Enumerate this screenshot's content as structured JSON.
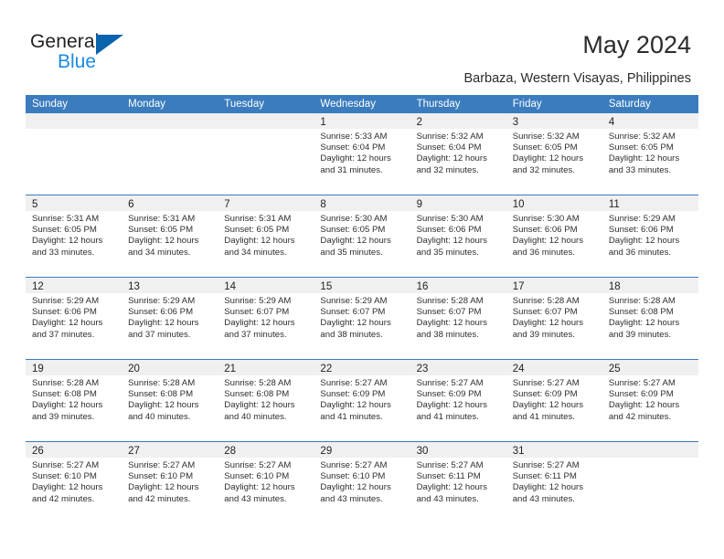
{
  "brand": {
    "name_primary": "General",
    "name_secondary": "Blue",
    "accent_color": "#0a64ac",
    "secondary_color": "#1b8ae0",
    "triangle_icon": "triangle-icon"
  },
  "header": {
    "title": "May 2024",
    "subtitle": "Barbaza, Western Visayas, Philippines"
  },
  "calendar": {
    "header_bg": "#3a7cbe",
    "daynum_bg": "#f0f0f0",
    "weekdays": [
      "Sunday",
      "Monday",
      "Tuesday",
      "Wednesday",
      "Thursday",
      "Friday",
      "Saturday"
    ],
    "weeks": [
      [
        {
          "day": "",
          "empty": true
        },
        {
          "day": "",
          "empty": true
        },
        {
          "day": "",
          "empty": true
        },
        {
          "day": "1",
          "sunrise": "Sunrise: 5:33 AM",
          "sunset": "Sunset: 6:04 PM",
          "daylight1": "Daylight: 12 hours",
          "daylight2": "and 31 minutes."
        },
        {
          "day": "2",
          "sunrise": "Sunrise: 5:32 AM",
          "sunset": "Sunset: 6:04 PM",
          "daylight1": "Daylight: 12 hours",
          "daylight2": "and 32 minutes."
        },
        {
          "day": "3",
          "sunrise": "Sunrise: 5:32 AM",
          "sunset": "Sunset: 6:05 PM",
          "daylight1": "Daylight: 12 hours",
          "daylight2": "and 32 minutes."
        },
        {
          "day": "4",
          "sunrise": "Sunrise: 5:32 AM",
          "sunset": "Sunset: 6:05 PM",
          "daylight1": "Daylight: 12 hours",
          "daylight2": "and 33 minutes."
        }
      ],
      [
        {
          "day": "5",
          "sunrise": "Sunrise: 5:31 AM",
          "sunset": "Sunset: 6:05 PM",
          "daylight1": "Daylight: 12 hours",
          "daylight2": "and 33 minutes."
        },
        {
          "day": "6",
          "sunrise": "Sunrise: 5:31 AM",
          "sunset": "Sunset: 6:05 PM",
          "daylight1": "Daylight: 12 hours",
          "daylight2": "and 34 minutes."
        },
        {
          "day": "7",
          "sunrise": "Sunrise: 5:31 AM",
          "sunset": "Sunset: 6:05 PM",
          "daylight1": "Daylight: 12 hours",
          "daylight2": "and 34 minutes."
        },
        {
          "day": "8",
          "sunrise": "Sunrise: 5:30 AM",
          "sunset": "Sunset: 6:05 PM",
          "daylight1": "Daylight: 12 hours",
          "daylight2": "and 35 minutes."
        },
        {
          "day": "9",
          "sunrise": "Sunrise: 5:30 AM",
          "sunset": "Sunset: 6:06 PM",
          "daylight1": "Daylight: 12 hours",
          "daylight2": "and 35 minutes."
        },
        {
          "day": "10",
          "sunrise": "Sunrise: 5:30 AM",
          "sunset": "Sunset: 6:06 PM",
          "daylight1": "Daylight: 12 hours",
          "daylight2": "and 36 minutes."
        },
        {
          "day": "11",
          "sunrise": "Sunrise: 5:29 AM",
          "sunset": "Sunset: 6:06 PM",
          "daylight1": "Daylight: 12 hours",
          "daylight2": "and 36 minutes."
        }
      ],
      [
        {
          "day": "12",
          "sunrise": "Sunrise: 5:29 AM",
          "sunset": "Sunset: 6:06 PM",
          "daylight1": "Daylight: 12 hours",
          "daylight2": "and 37 minutes."
        },
        {
          "day": "13",
          "sunrise": "Sunrise: 5:29 AM",
          "sunset": "Sunset: 6:06 PM",
          "daylight1": "Daylight: 12 hours",
          "daylight2": "and 37 minutes."
        },
        {
          "day": "14",
          "sunrise": "Sunrise: 5:29 AM",
          "sunset": "Sunset: 6:07 PM",
          "daylight1": "Daylight: 12 hours",
          "daylight2": "and 37 minutes."
        },
        {
          "day": "15",
          "sunrise": "Sunrise: 5:29 AM",
          "sunset": "Sunset: 6:07 PM",
          "daylight1": "Daylight: 12 hours",
          "daylight2": "and 38 minutes."
        },
        {
          "day": "16",
          "sunrise": "Sunrise: 5:28 AM",
          "sunset": "Sunset: 6:07 PM",
          "daylight1": "Daylight: 12 hours",
          "daylight2": "and 38 minutes."
        },
        {
          "day": "17",
          "sunrise": "Sunrise: 5:28 AM",
          "sunset": "Sunset: 6:07 PM",
          "daylight1": "Daylight: 12 hours",
          "daylight2": "and 39 minutes."
        },
        {
          "day": "18",
          "sunrise": "Sunrise: 5:28 AM",
          "sunset": "Sunset: 6:08 PM",
          "daylight1": "Daylight: 12 hours",
          "daylight2": "and 39 minutes."
        }
      ],
      [
        {
          "day": "19",
          "sunrise": "Sunrise: 5:28 AM",
          "sunset": "Sunset: 6:08 PM",
          "daylight1": "Daylight: 12 hours",
          "daylight2": "and 39 minutes."
        },
        {
          "day": "20",
          "sunrise": "Sunrise: 5:28 AM",
          "sunset": "Sunset: 6:08 PM",
          "daylight1": "Daylight: 12 hours",
          "daylight2": "and 40 minutes."
        },
        {
          "day": "21",
          "sunrise": "Sunrise: 5:28 AM",
          "sunset": "Sunset: 6:08 PM",
          "daylight1": "Daylight: 12 hours",
          "daylight2": "and 40 minutes."
        },
        {
          "day": "22",
          "sunrise": "Sunrise: 5:27 AM",
          "sunset": "Sunset: 6:09 PM",
          "daylight1": "Daylight: 12 hours",
          "daylight2": "and 41 minutes."
        },
        {
          "day": "23",
          "sunrise": "Sunrise: 5:27 AM",
          "sunset": "Sunset: 6:09 PM",
          "daylight1": "Daylight: 12 hours",
          "daylight2": "and 41 minutes."
        },
        {
          "day": "24",
          "sunrise": "Sunrise: 5:27 AM",
          "sunset": "Sunset: 6:09 PM",
          "daylight1": "Daylight: 12 hours",
          "daylight2": "and 41 minutes."
        },
        {
          "day": "25",
          "sunrise": "Sunrise: 5:27 AM",
          "sunset": "Sunset: 6:09 PM",
          "daylight1": "Daylight: 12 hours",
          "daylight2": "and 42 minutes."
        }
      ],
      [
        {
          "day": "26",
          "sunrise": "Sunrise: 5:27 AM",
          "sunset": "Sunset: 6:10 PM",
          "daylight1": "Daylight: 12 hours",
          "daylight2": "and 42 minutes."
        },
        {
          "day": "27",
          "sunrise": "Sunrise: 5:27 AM",
          "sunset": "Sunset: 6:10 PM",
          "daylight1": "Daylight: 12 hours",
          "daylight2": "and 42 minutes."
        },
        {
          "day": "28",
          "sunrise": "Sunrise: 5:27 AM",
          "sunset": "Sunset: 6:10 PM",
          "daylight1": "Daylight: 12 hours",
          "daylight2": "and 43 minutes."
        },
        {
          "day": "29",
          "sunrise": "Sunrise: 5:27 AM",
          "sunset": "Sunset: 6:10 PM",
          "daylight1": "Daylight: 12 hours",
          "daylight2": "and 43 minutes."
        },
        {
          "day": "30",
          "sunrise": "Sunrise: 5:27 AM",
          "sunset": "Sunset: 6:11 PM",
          "daylight1": "Daylight: 12 hours",
          "daylight2": "and 43 minutes."
        },
        {
          "day": "31",
          "sunrise": "Sunrise: 5:27 AM",
          "sunset": "Sunset: 6:11 PM",
          "daylight1": "Daylight: 12 hours",
          "daylight2": "and 43 minutes."
        },
        {
          "day": "",
          "empty": true
        }
      ]
    ]
  }
}
